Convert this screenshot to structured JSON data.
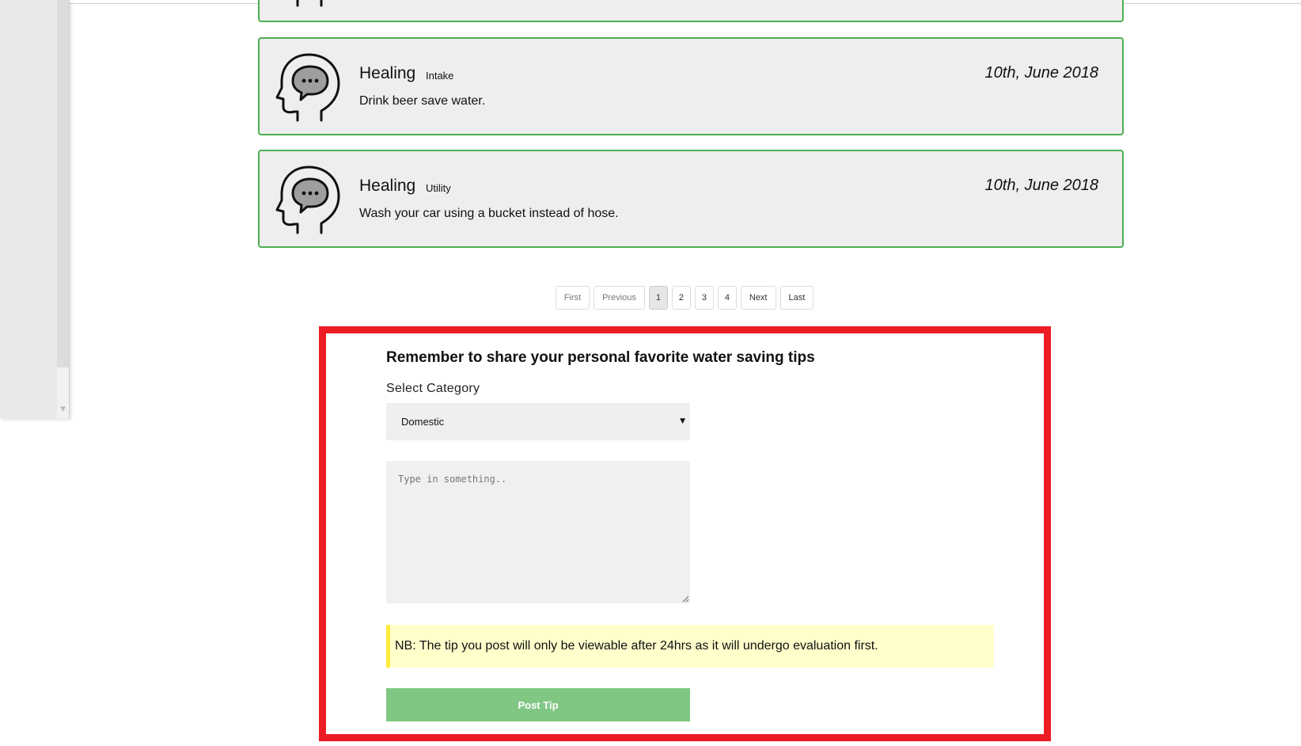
{
  "tips": [
    {
      "title": "Healing",
      "category": "Intake",
      "date": "10th, June 2018",
      "text": "Drink beer save water."
    },
    {
      "title": "Healing",
      "category": "Utility",
      "date": "10th, June 2018",
      "text": "Wash your car using a bucket instead of hose."
    }
  ],
  "pagination": {
    "first": "First",
    "previous": "Previous",
    "pages": [
      "1",
      "2",
      "3",
      "4"
    ],
    "current": "1",
    "next": "Next",
    "last": "Last"
  },
  "form": {
    "heading": "Remember to share your personal favorite water saving tips",
    "category_label": "Select Category",
    "category_value": "Domestic",
    "textarea_placeholder": "Type in something..",
    "note": "NB: The tip you post will only be viewable after 24hrs as it will undergo evaluation first.",
    "submit_label": "Post Tip"
  },
  "colors": {
    "card_border": "#4caf50",
    "card_background": "#eeeeee",
    "highlight_border": "#ed1c24",
    "note_background": "#ffffcc",
    "note_accent": "#ffeb3b",
    "button_background": "#81c784"
  },
  "icons": {
    "tip_avatar": "head-speech-bubble-icon",
    "select_caret": "caret-down-icon"
  }
}
